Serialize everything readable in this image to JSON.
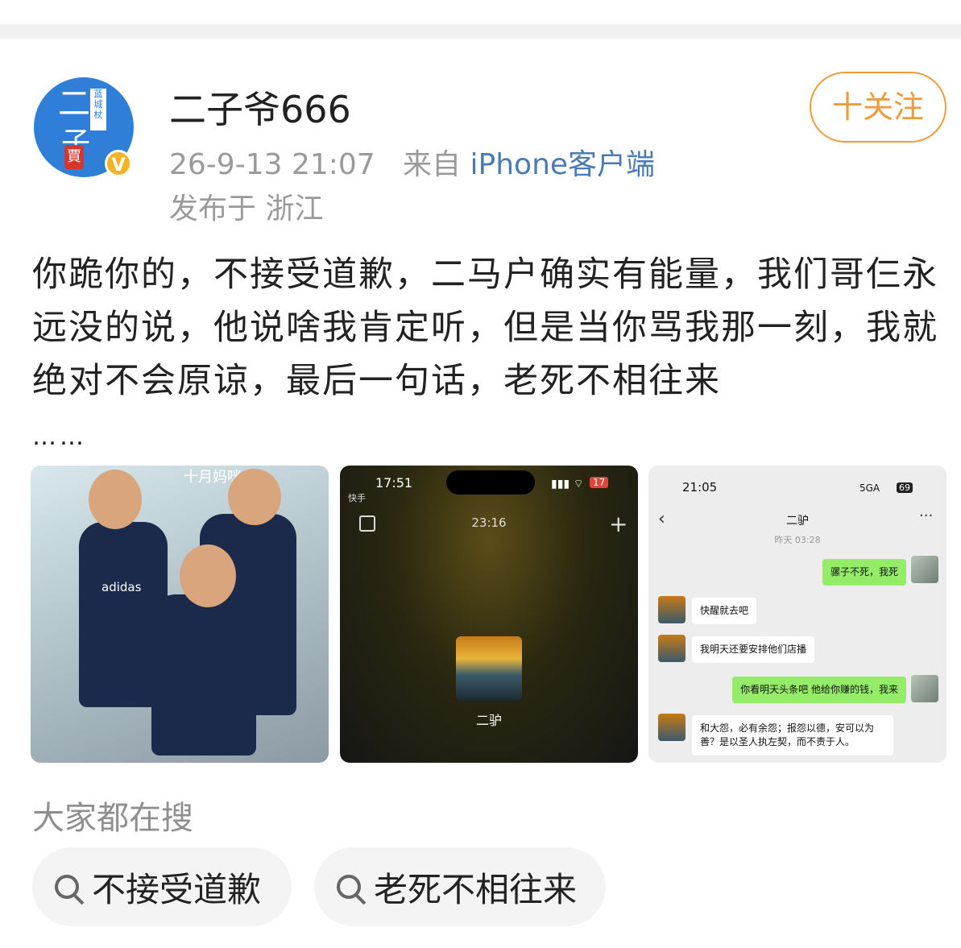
{
  "post": {
    "username": "二子爷666",
    "verified_badge": "V",
    "meta": {
      "date": "26-9-13 21:07",
      "from_prefix": "来自",
      "source": "iPhone客户端"
    },
    "location": "发布于 浙江",
    "follow_label": "十关注",
    "text": "你跪你的，不接受道歉，二马户确实有能量，我们哥仨永远没的说，他说啥我肯定听，但是当你骂我那一刻，我就绝对不会原谅，最后一句话，老死不相往来",
    "ellipsis": "……",
    "images": [
      {
        "caption": "十月妈咪",
        "shirt_text": "adidas"
      },
      {
        "status_time": "17:51",
        "app": "快手",
        "battery": "17",
        "clock": "23:16",
        "contact": "二驴"
      },
      {
        "status_time": "21:05",
        "network": "5GA",
        "battery": "69",
        "title": "二驴",
        "date": "昨天 03:28",
        "messages": [
          {
            "from": "me",
            "text": "骡子不死，我死"
          },
          {
            "from": "them",
            "text": "快醒就去吧"
          },
          {
            "from": "them",
            "text": "我明天还要安排他们店播"
          },
          {
            "from": "me",
            "text": "你看明天头条吧 他给你赚的钱，我来"
          },
          {
            "from": "them",
            "text": "和大怨，必有余怨；报怨以德，安可以为善？是以圣人执左契，而不责于人。"
          }
        ]
      }
    ]
  },
  "search": {
    "title": "大家都在搜",
    "chips": [
      "不接受道歉",
      "老死不相往来"
    ]
  }
}
